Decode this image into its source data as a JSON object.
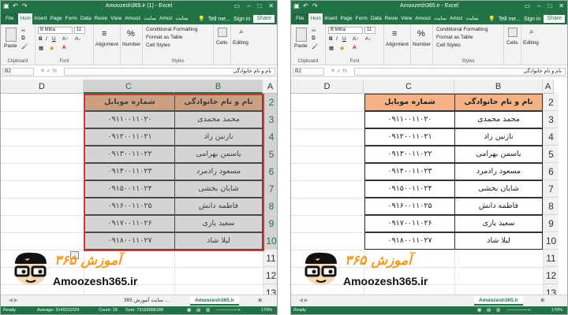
{
  "left": {
    "title": "Amoozesh365.ir (1) - Excel",
    "tabs": [
      "File",
      "Hom",
      "Insert",
      "Page",
      "Form",
      "Data",
      "Revie",
      "View",
      "Amooz",
      "سایت",
      "Amoz",
      "سایت"
    ],
    "tell_me": "Tell me...",
    "sign_in": "Sign in",
    "share": "Share",
    "name_box": "B2",
    "formula": "نام و نام خانوادگی",
    "font_name": "B Mitra",
    "font_size": "11",
    "columns": [
      "D",
      "C",
      "B",
      "A"
    ],
    "rows": [
      "2",
      "3",
      "4",
      "5",
      "6",
      "7",
      "8",
      "9",
      "10",
      "11",
      "12",
      "13"
    ],
    "sheet_tabs": [
      "سایت آموزش 365 ...",
      "Amoozesh365.ir"
    ],
    "status": {
      "ready": "Ready",
      "average": "Average: 9145011024",
      "count": "Count: 18",
      "sum": "Sum: 73160088188",
      "zoom": "170%"
    }
  },
  "right": {
    "title": "Amoozesh365.ir - Excel",
    "tabs": [
      "File",
      "Hom",
      "Insert",
      "Page",
      "Form",
      "Data",
      "Revie",
      "View",
      "Amooz",
      "سایت",
      "Amoz",
      "سایت"
    ],
    "tell_me": "Tell me...",
    "sign_in": "Sign in",
    "share": "Share",
    "name_box": "B2",
    "formula": "نام و نام خانوادگی",
    "font_name": "B Mitra",
    "font_size": "11",
    "columns": [
      "D",
      "C",
      "B",
      "A"
    ],
    "rows": [
      "2",
      "3",
      "4",
      "5",
      "6",
      "7",
      "8",
      "9",
      "10",
      "11",
      "12",
      "13"
    ],
    "sheet_tabs": [
      "Amoozesh365.ir"
    ],
    "status": {
      "ready": "Ready",
      "zoom": "170%"
    }
  },
  "ribbon": {
    "clipboard": "Clipboard",
    "paste": "Paste",
    "font": "Font",
    "alignment": "Alignment",
    "number": "Number",
    "conditional": "Conditional Formatting",
    "format_table": "Format as Table",
    "cell_styles": "Cell Styles",
    "styles": "Styles",
    "cells": "Cells",
    "editing": "Editing"
  },
  "table": {
    "headers": [
      "نام و نام خانوادگی",
      "شماره موبایل"
    ],
    "rows": [
      [
        "محمد محمدی",
        "۰۹۱۱۰۰۱۱۰۲۰"
      ],
      [
        "نازنین راد",
        "۰۹۱۲۰۰۱۱۰۲۱"
      ],
      [
        "یاسمن بهرامی",
        "۰۹۱۳۰۰۱۱۰۲۲"
      ],
      [
        "مسعود رادمرد",
        "۰۹۱۴۰۰۱۱۰۲۳"
      ],
      [
        "شایان بخشی",
        "۰۹۱۵۰۰۱۱۰۲۴"
      ],
      [
        "فاطمه دانش",
        "۰۹۱۶۰۰۱۱۰۲۵"
      ],
      [
        "سعید یاری",
        "۰۹۱۷۰۰۱۱۰۲۶"
      ],
      [
        "لیلا شاد",
        "۰۹۱۸۰۰۱۱۰۲۷"
      ]
    ]
  },
  "logo": {
    "brand": "آموزش ۳۶۵",
    "site": "Amoozesh365.ir"
  },
  "colors": {
    "excel_green": "#217346",
    "header_fill": "#f4b183",
    "selection_border": "#c43b3b"
  }
}
